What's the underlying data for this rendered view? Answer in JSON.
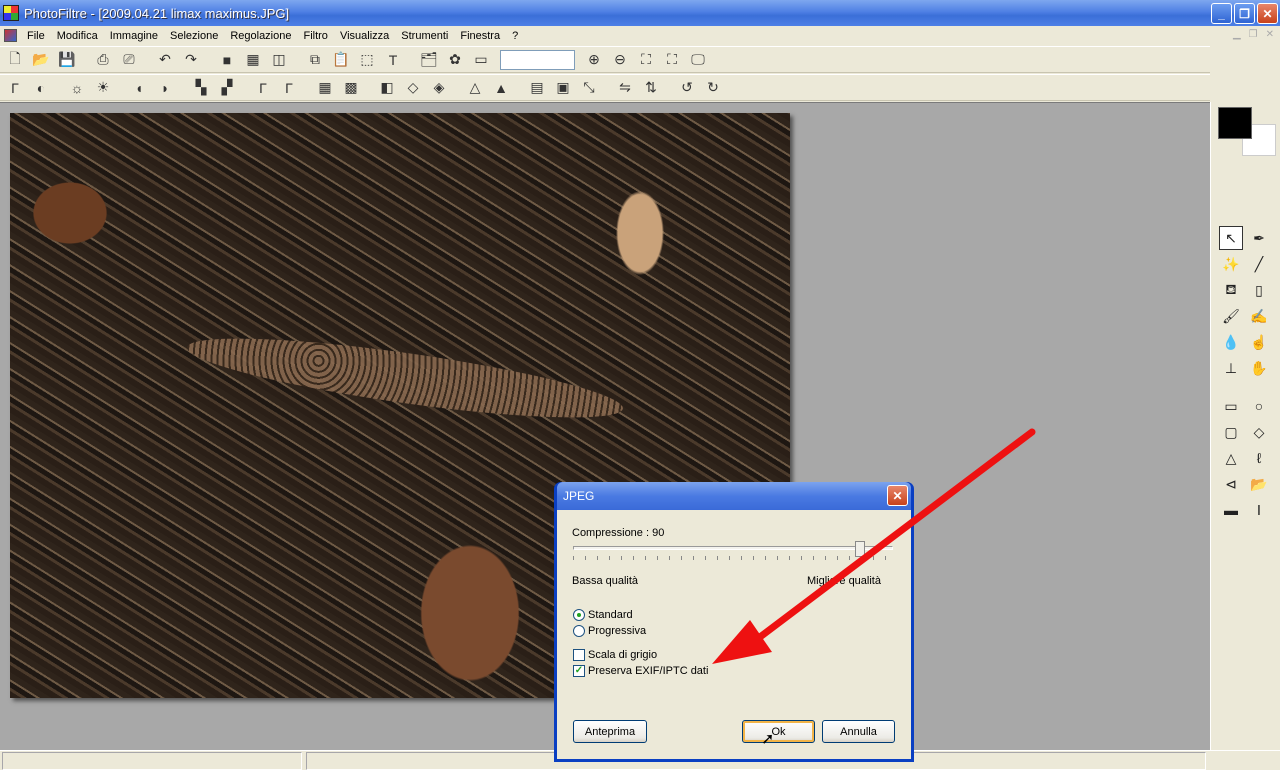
{
  "window": {
    "title": "PhotoFiltre - [2009.04.21 limax maximus.JPG]",
    "minimize": "_",
    "maximize": "❐",
    "close": "✕"
  },
  "menu": [
    "File",
    "Modifica",
    "Immagine",
    "Selezione",
    "Regolazione",
    "Filtro",
    "Visualizza",
    "Strumenti",
    "Finestra",
    "?"
  ],
  "toolbar1": {
    "zoom_value": ""
  },
  "toolbar2": {
    "text_tool_glyph": "T"
  },
  "dialog": {
    "title": "JPEG",
    "close": "✕",
    "compression_label": "Compressione : 90",
    "compression_value": 90,
    "low_quality": "Bassa qualità",
    "high_quality": "Migliore qualità",
    "mode_standard": "Standard",
    "mode_progressive": "Progressiva",
    "mode_selected": "Standard",
    "grayscale_label": "Scala di grigio",
    "grayscale_checked": false,
    "exif_label": "Preserva EXIF/IPTC dati",
    "exif_checked": true,
    "checkmark": "✓",
    "preview_button": "Anteprima",
    "ok_button": "Ok",
    "cancel_button": "Annulla"
  },
  "colors": {
    "foreground": "#000000",
    "background": "#ffffff",
    "annotation_arrow": "#ee1111"
  }
}
